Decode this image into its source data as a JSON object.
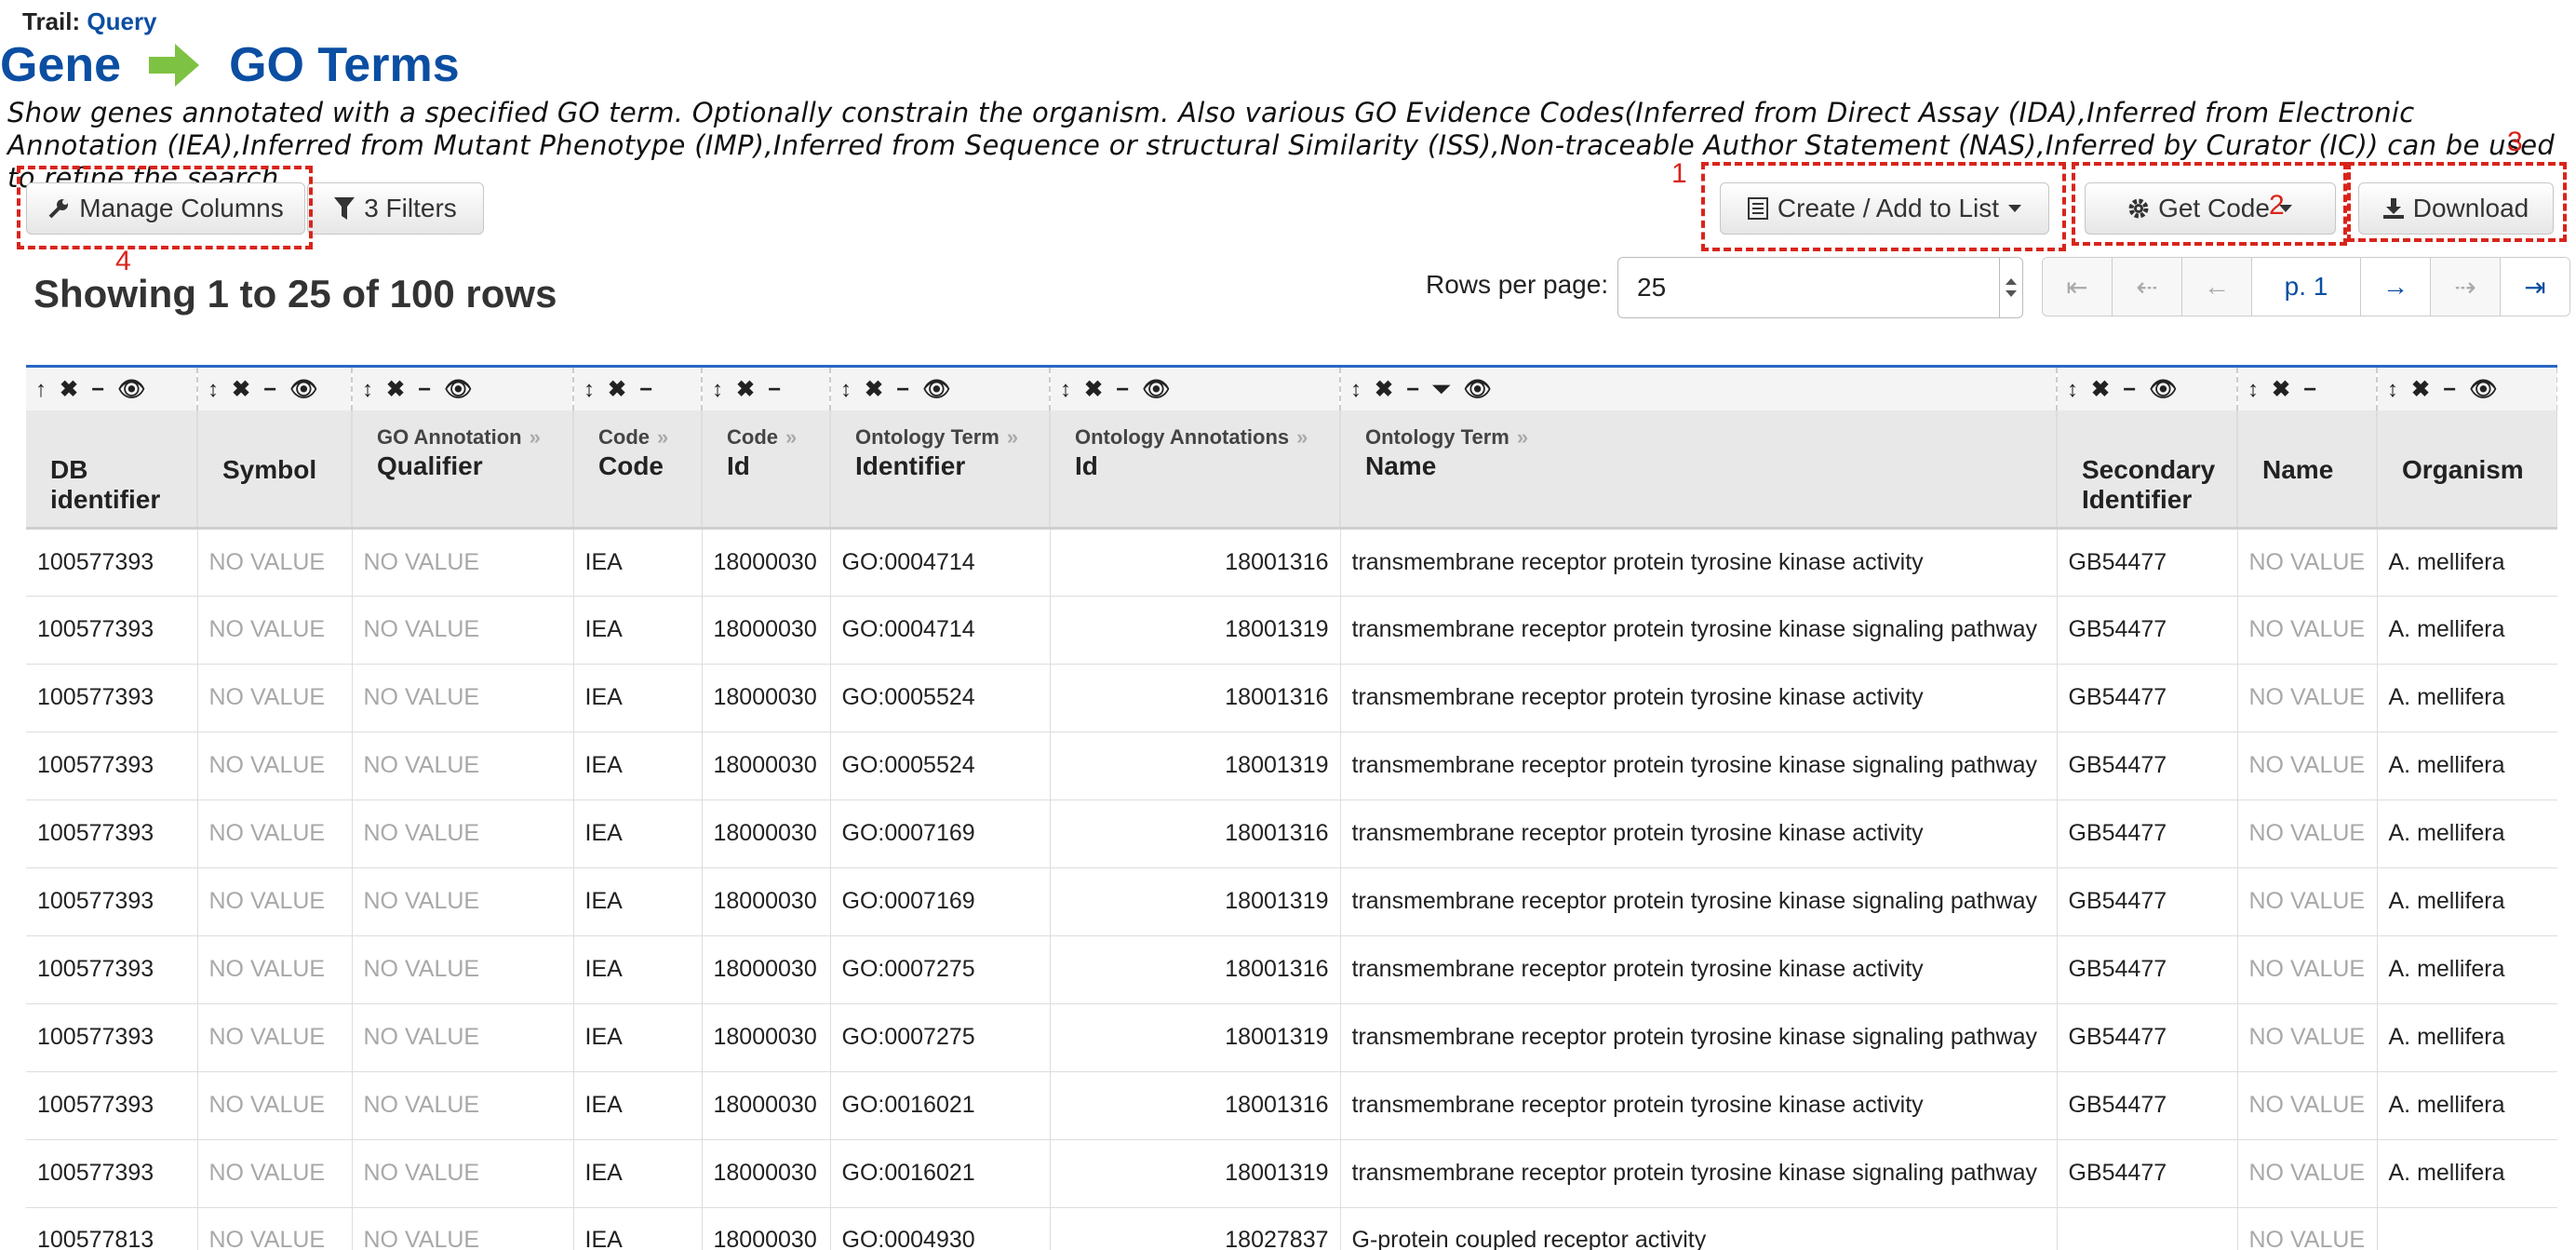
{
  "trail": {
    "label": "Trail:",
    "link": "Query"
  },
  "title": {
    "left": "Gene",
    "right": "GO Terms"
  },
  "description": "Show genes annotated with a specified GO term. Optionally constrain the organism. Also various GO Evidence Codes(Inferred from Direct Assay (IDA),Inferred from Electronic Annotation (IEA),Inferred from Mutant Phenotype (IMP),Inferred from Sequence or structural Similarity (ISS),Non-traceable Author Statement (NAS),Inferred by Curator (IC)) can be used to refine the search",
  "toolbar": {
    "manage_columns": "Manage Columns",
    "filters": "3 Filters",
    "create_list": "Create / Add to List",
    "get_code": "Get Code",
    "download": "Download"
  },
  "annotations": {
    "a1": "1",
    "a2": "2",
    "a3": "3",
    "a4": "4"
  },
  "showing": "Showing 1 to 25 of 100 rows",
  "rows_per_page": {
    "label": "Rows per page:",
    "value": "25"
  },
  "pager": {
    "first": "⇤",
    "prev_far": "⇠",
    "prev": "←",
    "page": "p. 1",
    "next": "→",
    "next_far": "⇢",
    "last": "⇥"
  },
  "columns": [
    {
      "parent": "",
      "name": "DB identifier"
    },
    {
      "parent": "",
      "name": "Symbol"
    },
    {
      "parent": "GO Annotation",
      "name": "Qualifier"
    },
    {
      "parent": "Code",
      "name": "Code"
    },
    {
      "parent": "Code",
      "name": "Id"
    },
    {
      "parent": "Ontology Term",
      "name": "Identifier"
    },
    {
      "parent": "Ontology Annotations",
      "name": "Id"
    },
    {
      "parent": "Ontology Term",
      "name": "Name"
    },
    {
      "parent": "",
      "name": "Secondary Identifier"
    },
    {
      "parent": "",
      "name": "Name"
    },
    {
      "parent": "",
      "name": "Organism"
    }
  ],
  "rows": [
    [
      "100577393",
      "NO VALUE",
      "NO VALUE",
      "IEA",
      "18000030",
      "GO:0004714",
      "18001316",
      "transmembrane receptor protein tyrosine kinase activity",
      "GB54477",
      "NO VALUE",
      "A. mellifera"
    ],
    [
      "100577393",
      "NO VALUE",
      "NO VALUE",
      "IEA",
      "18000030",
      "GO:0004714",
      "18001319",
      "transmembrane receptor protein tyrosine kinase signaling pathway",
      "GB54477",
      "NO VALUE",
      "A. mellifera"
    ],
    [
      "100577393",
      "NO VALUE",
      "NO VALUE",
      "IEA",
      "18000030",
      "GO:0005524",
      "18001316",
      "transmembrane receptor protein tyrosine kinase activity",
      "GB54477",
      "NO VALUE",
      "A. mellifera"
    ],
    [
      "100577393",
      "NO VALUE",
      "NO VALUE",
      "IEA",
      "18000030",
      "GO:0005524",
      "18001319",
      "transmembrane receptor protein tyrosine kinase signaling pathway",
      "GB54477",
      "NO VALUE",
      "A. mellifera"
    ],
    [
      "100577393",
      "NO VALUE",
      "NO VALUE",
      "IEA",
      "18000030",
      "GO:0007169",
      "18001316",
      "transmembrane receptor protein tyrosine kinase activity",
      "GB54477",
      "NO VALUE",
      "A. mellifera"
    ],
    [
      "100577393",
      "NO VALUE",
      "NO VALUE",
      "IEA",
      "18000030",
      "GO:0007169",
      "18001319",
      "transmembrane receptor protein tyrosine kinase signaling pathway",
      "GB54477",
      "NO VALUE",
      "A. mellifera"
    ],
    [
      "100577393",
      "NO VALUE",
      "NO VALUE",
      "IEA",
      "18000030",
      "GO:0007275",
      "18001316",
      "transmembrane receptor protein tyrosine kinase activity",
      "GB54477",
      "NO VALUE",
      "A. mellifera"
    ],
    [
      "100577393",
      "NO VALUE",
      "NO VALUE",
      "IEA",
      "18000030",
      "GO:0007275",
      "18001319",
      "transmembrane receptor protein tyrosine kinase signaling pathway",
      "GB54477",
      "NO VALUE",
      "A. mellifera"
    ],
    [
      "100577393",
      "NO VALUE",
      "NO VALUE",
      "IEA",
      "18000030",
      "GO:0016021",
      "18001316",
      "transmembrane receptor protein tyrosine kinase activity",
      "GB54477",
      "NO VALUE",
      "A. mellifera"
    ],
    [
      "100577393",
      "NO VALUE",
      "NO VALUE",
      "IEA",
      "18000030",
      "GO:0016021",
      "18001319",
      "transmembrane receptor protein tyrosine kinase signaling pathway",
      "GB54477",
      "NO VALUE",
      "A. mellifera"
    ],
    [
      "100577813",
      "NO VALUE",
      "NO VALUE",
      "IEA",
      "18000030",
      "GO:0004930",
      "18027837",
      "G-protein coupled receptor activity",
      "",
      "NO VALUE",
      ""
    ]
  ],
  "colors": {
    "brand": "#0b4ea2",
    "annotation": "#d9241b",
    "arrow": "#7dc242"
  }
}
